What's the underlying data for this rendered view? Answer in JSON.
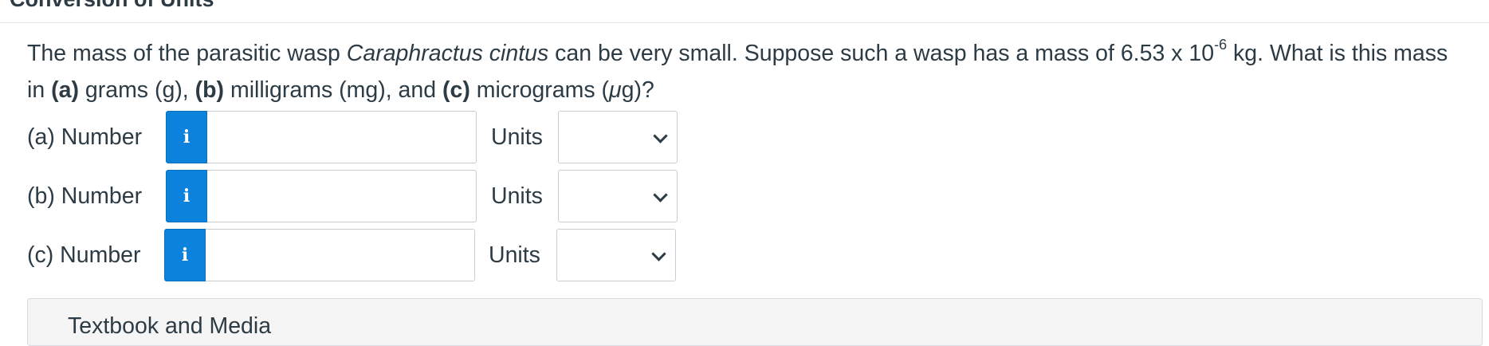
{
  "header": {
    "cut_title": "Conversion of Units"
  },
  "question": {
    "intro": "The mass of the parasitic wasp ",
    "species": "Caraphractus cintus",
    "mid": " can be very small. Suppose such a wasp has a mass of 6.53 x 10",
    "exponent": "-6",
    "after_exp": " kg. What is this mass in ",
    "part_a": "(a)",
    "part_a_text": " grams (g), ",
    "part_b": "(b)",
    "part_b_text": " milligrams (mg), and ",
    "part_c": "(c)",
    "part_c_text": " micrograms (",
    "mu": "μ",
    "part_c_end": "g)?"
  },
  "answers": [
    {
      "label": "(a) Number",
      "info_icon": "i",
      "value": "",
      "units_label": "Units",
      "units_selected": ""
    },
    {
      "label": "(b) Number",
      "info_icon": "i",
      "value": "",
      "units_label": "Units",
      "units_selected": ""
    },
    {
      "label": "(c) Number",
      "info_icon": "i",
      "value": "",
      "units_label": "Units",
      "units_selected": ""
    }
  ],
  "media_panel": {
    "title": "Textbook and Media"
  },
  "colors": {
    "info_button": "#0c82dc",
    "text": "#2d3b45",
    "border": "#c7cdd1"
  }
}
